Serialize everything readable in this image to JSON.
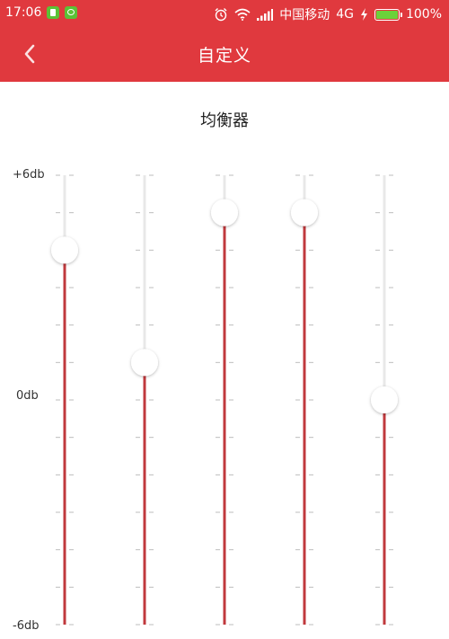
{
  "status_bar": {
    "time": "17:06",
    "carrier": "中国移动",
    "network": "4G",
    "battery_percent": "100%",
    "battery_level": 1.0,
    "icons": [
      "notes-app-icon",
      "wechat-app-icon",
      "alarm-icon",
      "wifi-icon",
      "signal-icon",
      "charging-icon",
      "battery-icon"
    ]
  },
  "header": {
    "title": "自定义",
    "back_icon": "chevron-left-icon"
  },
  "equalizer": {
    "title": "均衡器",
    "scale_labels": {
      "max": "+6db",
      "mid": "0db",
      "min": "-6db"
    },
    "range_db": [
      -6,
      6
    ],
    "bands_db": [
      4,
      1,
      5,
      5,
      0
    ],
    "colors": {
      "active_track": "#C0393D",
      "inactive_track": "#E8E8E8",
      "tick": "#BDBDBD",
      "knob": "#FFFFFF"
    }
  },
  "colors": {
    "header_bg": "#E0393E",
    "header_text": "#FFFFFF"
  }
}
